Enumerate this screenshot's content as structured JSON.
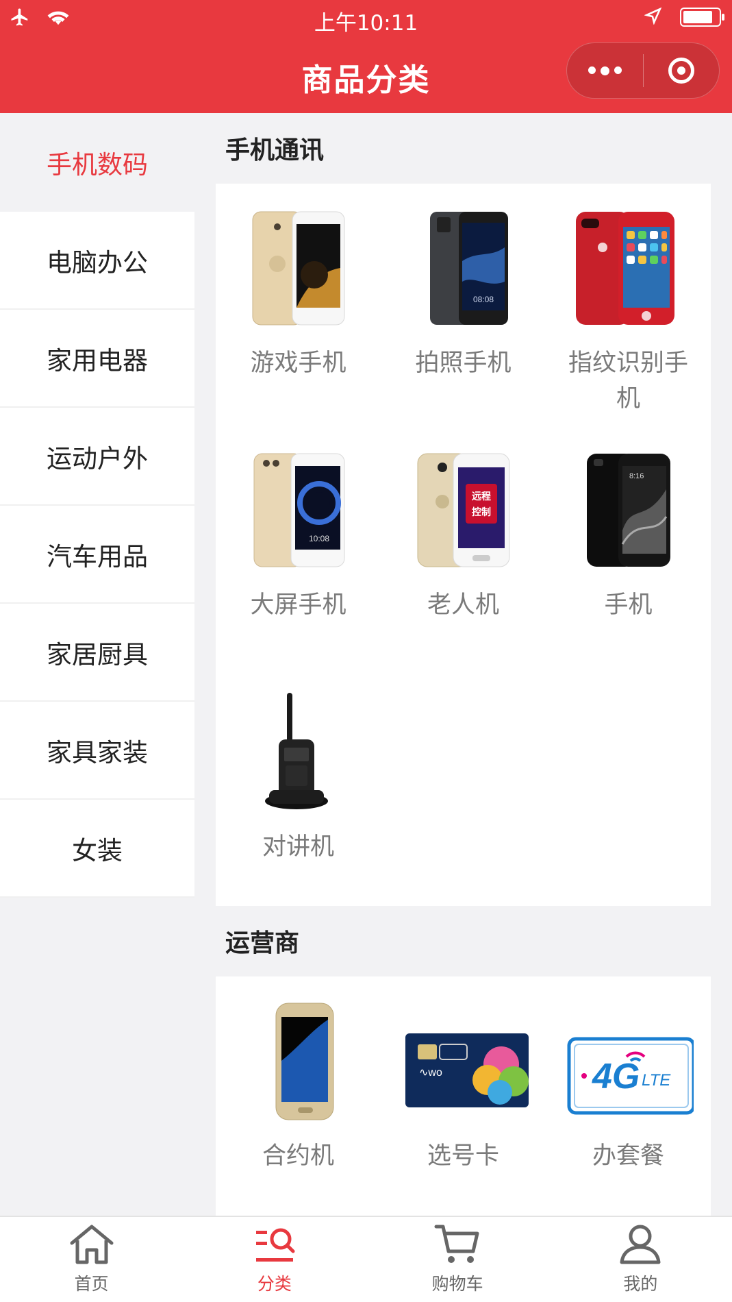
{
  "status_bar": {
    "time": "上午10:11"
  },
  "header": {
    "title": "商品分类"
  },
  "sidebar": {
    "items": [
      {
        "label": "手机数码",
        "active": true
      },
      {
        "label": "电脑办公"
      },
      {
        "label": "家用电器"
      },
      {
        "label": "运动户外"
      },
      {
        "label": "汽车用品"
      },
      {
        "label": "家居厨具"
      },
      {
        "label": "家具家装"
      },
      {
        "label": "女装"
      }
    ]
  },
  "sections": [
    {
      "title": "手机通讯",
      "items": [
        {
          "label": "游戏手机",
          "icon": "gold-phone-image"
        },
        {
          "label": "拍照手机",
          "icon": "gray-phone-image"
        },
        {
          "label": "指纹识别手机",
          "icon": "red-phone-image"
        },
        {
          "label": "大屏手机",
          "icon": "gold-phone-image-2"
        },
        {
          "label": "老人机",
          "icon": "senior-phone-image"
        },
        {
          "label": "手机",
          "icon": "black-phone-image"
        },
        {
          "label": "对讲机",
          "icon": "walkie-talkie-image"
        }
      ]
    },
    {
      "title": "运营商",
      "items": [
        {
          "label": "合约机",
          "icon": "contract-phone-image"
        },
        {
          "label": "选号卡",
          "icon": "sim-card-image"
        },
        {
          "label": "办套餐",
          "icon": "4g-lte-plan-image"
        }
      ]
    }
  ],
  "tabbar": {
    "items": [
      {
        "label": "首页",
        "icon": "home-icon"
      },
      {
        "label": "分类",
        "icon": "category-icon",
        "active": true
      },
      {
        "label": "购物车",
        "icon": "cart-icon"
      },
      {
        "label": "我的",
        "icon": "user-icon"
      }
    ]
  },
  "colors": {
    "brand": "#e8393f",
    "background": "#f2f2f4",
    "text_gray": "#7a7a7a"
  }
}
